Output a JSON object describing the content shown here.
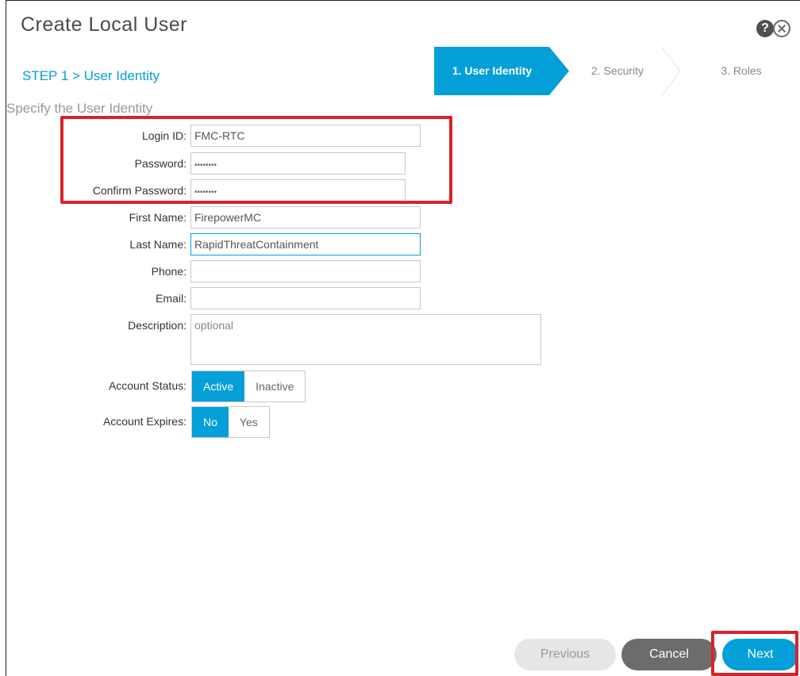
{
  "dialog": {
    "title": "Create Local User",
    "help_icon": "question-mark-icon",
    "close_icon": "close-icon"
  },
  "step_heading": "STEP 1 > User Identity",
  "wizard": {
    "steps": [
      {
        "label": "1. User Identity",
        "active": true
      },
      {
        "label": "2. Security",
        "active": false
      },
      {
        "label": "3. Roles",
        "active": false
      }
    ]
  },
  "section_title": "Specify the User Identity",
  "form": {
    "login_id": {
      "label": "Login ID:",
      "value": "FMC-RTC"
    },
    "password": {
      "label": "Password:",
      "value": "••••••••"
    },
    "confirm_password": {
      "label": "Confirm Password:",
      "value": "••••••••"
    },
    "first_name": {
      "label": "First Name:",
      "value": "FirepowerMC"
    },
    "last_name": {
      "label": "Last Name:",
      "value": "RapidThreatContainment"
    },
    "phone": {
      "label": "Phone:",
      "value": ""
    },
    "email": {
      "label": "Email:",
      "value": ""
    },
    "description": {
      "label": "Description:",
      "placeholder": "optional"
    },
    "account_status": {
      "label": "Account Status:",
      "options": [
        "Active",
        "Inactive"
      ],
      "selected": "Active"
    },
    "account_expires": {
      "label": "Account Expires:",
      "options": [
        "No",
        "Yes"
      ],
      "selected": "No"
    }
  },
  "buttons": {
    "previous": "Previous",
    "cancel": "Cancel",
    "next": "Next"
  },
  "colors": {
    "accent": "#049fd9",
    "highlight": "#d8232a"
  }
}
